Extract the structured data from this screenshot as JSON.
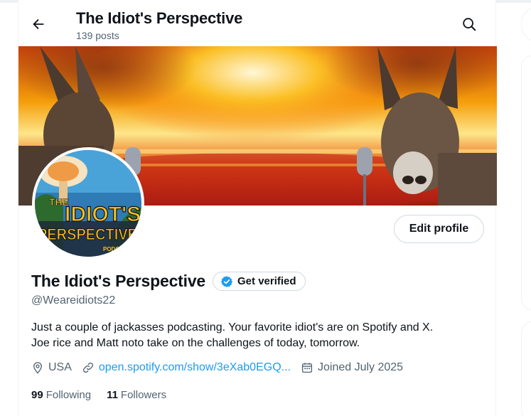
{
  "header": {
    "title": "The Idiot's Perspective",
    "post_count": "139 posts",
    "back_icon": "arrow-left-icon",
    "search_icon": "search-icon"
  },
  "banner": {
    "description_icon": "banner-image"
  },
  "avatar": {
    "logo_text_line1": "THE",
    "logo_text_line2": "IDIOT'S",
    "logo_text_line3": "PERSPECTIVE",
    "logo_text_line4": "PODC"
  },
  "profile": {
    "edit_label": "Edit profile",
    "display_name": "The Idiot's Perspective",
    "verify_label": "Get verified",
    "handle": "@Weareidiots22",
    "bio_line1": "Just a couple of jackasses podcasting. Your favorite idiot's are on Spotify and X.",
    "bio_line2": "Joe rice and Matt noto take on the challenges of today, tomorrow.",
    "location": "USA",
    "website": "open.spotify.com/show/3eXab0EGQ...",
    "joined": "Joined July 2025"
  },
  "stats": {
    "following_count": "99",
    "following_label": "Following",
    "followers_count": "11",
    "followers_label": "Followers"
  },
  "colors": {
    "accent": "#1d9bf0",
    "text_primary": "#0f1419",
    "text_secondary": "#536471",
    "border": "#cfd9de"
  }
}
